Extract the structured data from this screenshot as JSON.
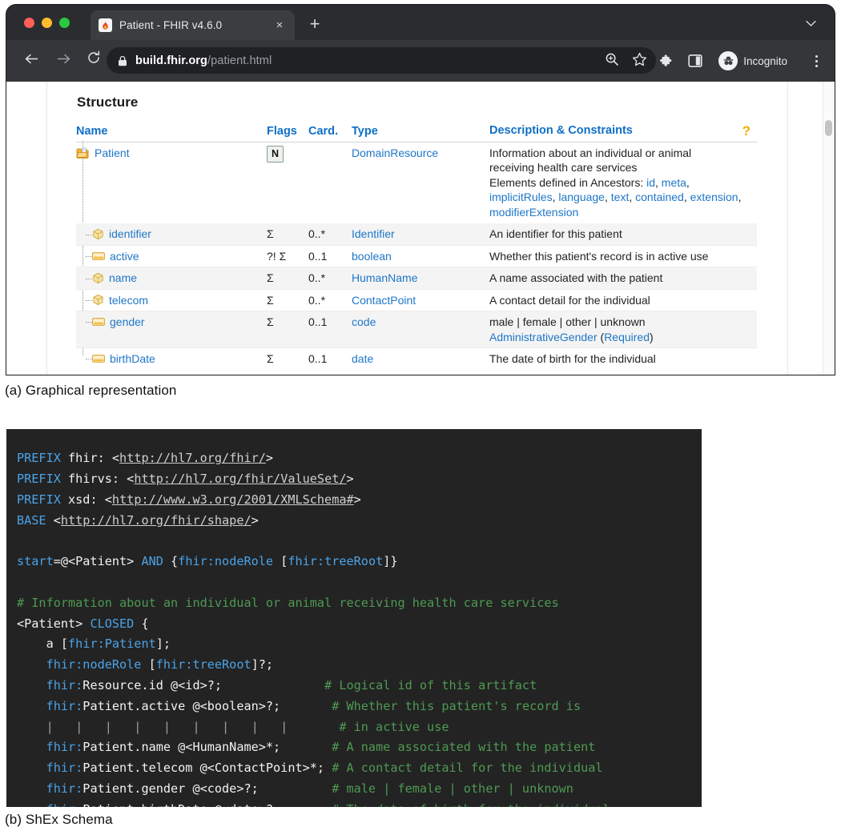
{
  "browser": {
    "window_controls": [
      "close",
      "minimize",
      "maximize"
    ],
    "tab": {
      "title": "Patient - FHIR v4.6.0",
      "close_label": "×",
      "favicon": "fhir-flame-icon"
    },
    "new_tab_label": "+",
    "tabstrip_chevron": "⌄",
    "nav": {
      "back": "←",
      "forward": "→",
      "reload": "↻"
    },
    "omnibox": {
      "lock_icon": "lock-icon",
      "host": "build.fhir.org",
      "path": "/patient.html",
      "zoom_icon": "zoom-search-icon",
      "bookmark_icon": "star-icon"
    },
    "toolbar": {
      "extensions_icon": "puzzle-icon",
      "side_panel_icon": "side-panel-icon",
      "profile_label": "Incognito",
      "profile_icon": "incognito-hat-glasses-icon",
      "menu_icon": "kebab-menu-icon"
    }
  },
  "page": {
    "heading": "Structure",
    "help_icon": "?",
    "columns": [
      "Name",
      "Flags",
      "Card.",
      "Type",
      "Description & Constraints"
    ],
    "rows": [
      {
        "icon": "folder-open-icon",
        "indent": 0,
        "name": "Patient",
        "flags_badge": "N",
        "flags": "",
        "card": "",
        "type": "DomainResource",
        "desc_lines": [
          "Information about an individual or animal",
          "receiving health care services"
        ],
        "ancestors_prefix": "Elements defined in Ancestors: ",
        "ancestors": [
          "id",
          "meta",
          "implicitRules",
          "language",
          "text",
          "contained",
          "extension",
          "modifierExtension"
        ]
      },
      {
        "icon": "datatype-cube-icon",
        "indent": 1,
        "name": "identifier",
        "flags": "Σ",
        "card": "0..*",
        "type": "Identifier",
        "desc": "An identifier for this patient"
      },
      {
        "icon": "primitive-field-icon",
        "indent": 1,
        "name": "active",
        "flags": "?! Σ",
        "card": "0..1",
        "type": "boolean",
        "desc": "Whether this patient's record is in active use"
      },
      {
        "icon": "datatype-cube-icon",
        "indent": 1,
        "name": "name",
        "flags": "Σ",
        "card": "0..*",
        "type": "HumanName",
        "desc": "A name associated with the patient"
      },
      {
        "icon": "datatype-cube-icon",
        "indent": 1,
        "name": "telecom",
        "flags": "Σ",
        "card": "0..*",
        "type": "ContactPoint",
        "desc": "A contact detail for the individual"
      },
      {
        "icon": "primitive-field-icon",
        "indent": 1,
        "name": "gender",
        "flags": "Σ",
        "card": "0..1",
        "type": "code",
        "desc": "male | female | other | unknown",
        "binding_link": "AdministrativeGender",
        "binding_open": " (",
        "binding_strength": "Required",
        "binding_close": ")"
      },
      {
        "icon": "primitive-field-icon",
        "indent": 1,
        "name": "birthDate",
        "flags": "Σ",
        "card": "0..1",
        "type": "date",
        "desc": "The date of birth for the individual"
      }
    ]
  },
  "captions": {
    "a": "(a) Graphical representation",
    "b": "(b) ShEx Schema"
  },
  "shex": {
    "lines": [
      [
        {
          "t": "PREFIX ",
          "c": "kw"
        },
        {
          "t": "fhir: ",
          "c": "txt"
        },
        {
          "t": "<",
          "c": "txt"
        },
        {
          "t": "http://hl7.org/fhir/",
          "c": "ln"
        },
        {
          "t": ">",
          "c": "txt"
        }
      ],
      [
        {
          "t": "PREFIX ",
          "c": "kw"
        },
        {
          "t": "fhirvs: ",
          "c": "txt"
        },
        {
          "t": "<",
          "c": "txt"
        },
        {
          "t": "http://hl7.org/fhir/ValueSet/",
          "c": "ln"
        },
        {
          "t": ">",
          "c": "txt"
        }
      ],
      [
        {
          "t": "PREFIX ",
          "c": "kw"
        },
        {
          "t": "xsd: ",
          "c": "txt"
        },
        {
          "t": "<",
          "c": "txt"
        },
        {
          "t": "http://www.w3.org/2001/XMLSchema#",
          "c": "ln"
        },
        {
          "t": ">",
          "c": "txt"
        }
      ],
      [
        {
          "t": "BASE ",
          "c": "kw"
        },
        {
          "t": "<",
          "c": "txt"
        },
        {
          "t": "http://hl7.org/fhir/shape/",
          "c": "ln"
        },
        {
          "t": ">",
          "c": "txt"
        }
      ],
      [],
      [
        {
          "t": "start",
          "c": "kw"
        },
        {
          "t": "=@<Patient> ",
          "c": "txt"
        },
        {
          "t": "AND",
          "c": "kw"
        },
        {
          "t": " {",
          "c": "txt"
        },
        {
          "t": "fhir:nodeRole",
          "c": "kw"
        },
        {
          "t": " [",
          "c": "txt"
        },
        {
          "t": "fhir:treeRoot",
          "c": "kw"
        },
        {
          "t": "]}",
          "c": "txt"
        }
      ],
      [],
      [
        {
          "t": "# Information about an individual or animal receiving health care services",
          "c": "cm"
        }
      ],
      [
        {
          "t": "<Patient> ",
          "c": "txt"
        },
        {
          "t": "CLOSED",
          "c": "kw"
        },
        {
          "t": " {",
          "c": "txt"
        }
      ],
      [
        {
          "t": "    a [",
          "c": "txt"
        },
        {
          "t": "fhir:Patient",
          "c": "kw"
        },
        {
          "t": "];",
          "c": "txt"
        }
      ],
      [
        {
          "t": "    ",
          "c": "txt"
        },
        {
          "t": "fhir:nodeRole",
          "c": "kw"
        },
        {
          "t": " [",
          "c": "txt"
        },
        {
          "t": "fhir:treeRoot",
          "c": "kw"
        },
        {
          "t": "]?;",
          "c": "txt"
        }
      ],
      [
        {
          "t": "    ",
          "c": "txt"
        },
        {
          "t": "fhir:",
          "c": "kw"
        },
        {
          "t": "Resource.id @<id>?;",
          "c": "txt"
        },
        {
          "t": "              ",
          "c": "txt"
        },
        {
          "t": "# Logical id of this artifact",
          "c": "cm"
        }
      ],
      [
        {
          "t": "    ",
          "c": "txt"
        },
        {
          "t": "fhir:",
          "c": "kw"
        },
        {
          "t": "Patient.active @<boolean>?;",
          "c": "txt"
        },
        {
          "t": "       ",
          "c": "txt"
        },
        {
          "t": "# Whether this patient's record is",
          "c": "cm"
        }
      ],
      [
        {
          "t": "    |   |   |   |   |   |   |   |   |  ",
          "c": "gd"
        },
        {
          "t": "     ",
          "c": "txt"
        },
        {
          "t": "# in active use",
          "c": "cm"
        }
      ],
      [
        {
          "t": "    ",
          "c": "txt"
        },
        {
          "t": "fhir:",
          "c": "kw"
        },
        {
          "t": "Patient.name @<HumanName>*;",
          "c": "txt"
        },
        {
          "t": "       ",
          "c": "txt"
        },
        {
          "t": "# A name associated with the patient",
          "c": "cm"
        }
      ],
      [
        {
          "t": "    ",
          "c": "txt"
        },
        {
          "t": "fhir:",
          "c": "kw"
        },
        {
          "t": "Patient.telecom @<ContactPoint>*;",
          "c": "txt"
        },
        {
          "t": " ",
          "c": "txt"
        },
        {
          "t": "# A contact detail for the individual",
          "c": "cm"
        }
      ],
      [
        {
          "t": "    ",
          "c": "txt"
        },
        {
          "t": "fhir:",
          "c": "kw"
        },
        {
          "t": "Patient.gender @<code>?;",
          "c": "txt"
        },
        {
          "t": "          ",
          "c": "txt"
        },
        {
          "t": "# male | female | other | unknown",
          "c": "cm"
        }
      ],
      [
        {
          "t": "    ",
          "c": "txt"
        },
        {
          "t": "fhir:",
          "c": "kw"
        },
        {
          "t": "Patient.birthDate @<date>?;",
          "c": "txt"
        },
        {
          "t": "       ",
          "c": "txt"
        },
        {
          "t": "# The date of birth for the individual",
          "c": "cm"
        }
      ]
    ]
  },
  "colors": {
    "link": "#1f76c8",
    "header_link": "#0f6fc6",
    "chrome_dark": "#202124",
    "tabstrip": "#2b2c2f",
    "navbar": "#35363a",
    "code_bg": "#232323",
    "code_keyword": "#4aa3e8",
    "code_comment": "#4e9a52",
    "code_text": "#f2f2f2",
    "flag_badge_bg": "#eef2ee",
    "zebra": "#f4f4f4"
  }
}
